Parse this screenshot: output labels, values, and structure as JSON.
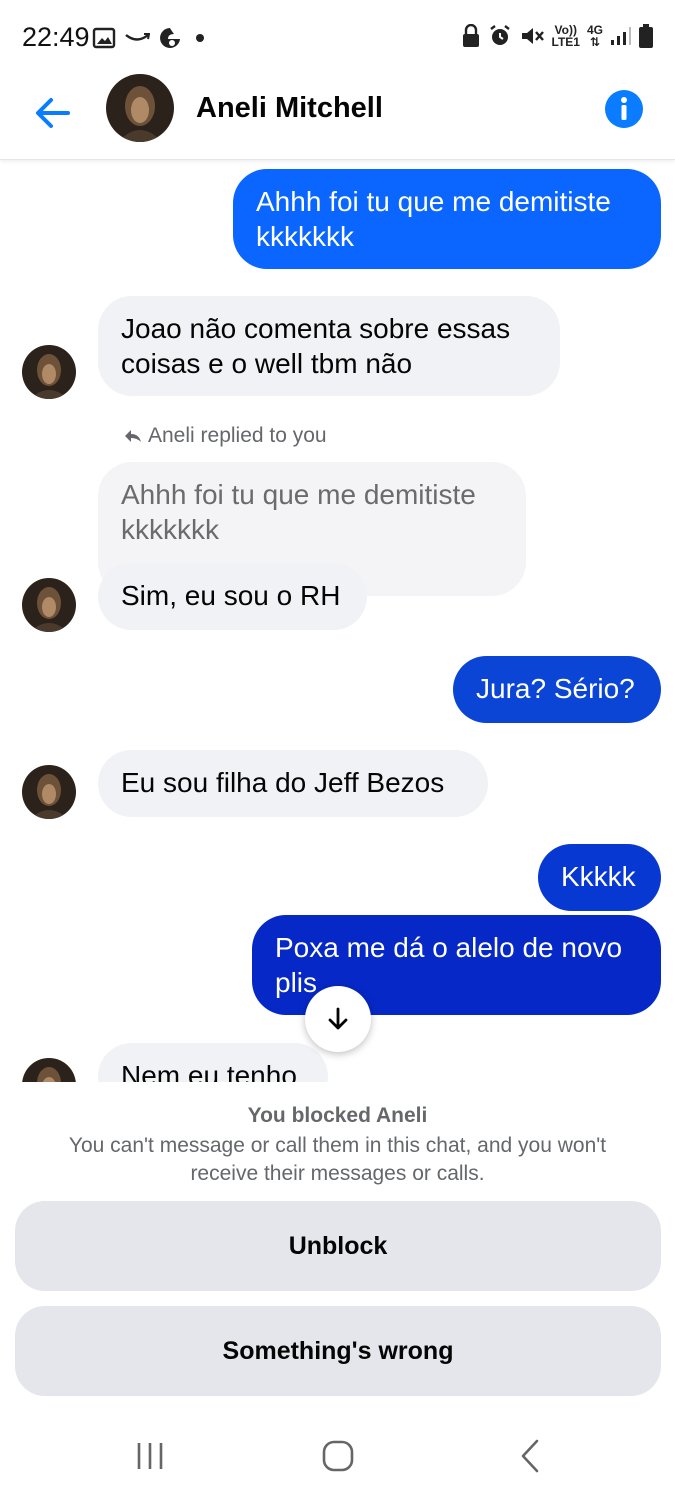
{
  "status_bar": {
    "time": "22:49",
    "left_icons": [
      "gallery-icon",
      "amazon-icon",
      "edge-icon",
      "dot-icon"
    ],
    "right_icons": [
      "lock-icon",
      "alarm-icon",
      "mute-icon",
      "volte-icon",
      "4g-icon",
      "signal-icon",
      "battery-icon"
    ],
    "volte_top": "Vo))",
    "volte_bottom": "LTE1",
    "network": "4G"
  },
  "header": {
    "contact_name": "Aneli Mitchell",
    "back_icon": "arrow-left-icon",
    "info_icon": "info-icon",
    "accent": "#0a7cff"
  },
  "messages": [
    {
      "direction": "out",
      "text": "Ahhh foi tu que me demitiste kkkkkkk",
      "color": "#0a66ff"
    },
    {
      "direction": "in",
      "text": "Joao não comenta sobre essas coisas e o well tbm não"
    },
    {
      "direction": "in",
      "reply_label": "Aneli replied to you",
      "quoted_text": "Ahhh foi tu que me demitiste kkkkkkk",
      "text": "Sim, eu sou o RH"
    },
    {
      "direction": "out",
      "text": "Jura? Sério?",
      "color": "#0b45d6"
    },
    {
      "direction": "in",
      "text": "Eu sou filha do Jeff Bezos"
    },
    {
      "direction": "out",
      "text": "Kkkkk",
      "color": "#0838d2"
    },
    {
      "direction": "out",
      "text": "Poxa me dá o alelo de novo plis",
      "color": "#0628c6"
    },
    {
      "direction": "in",
      "text": "Nem eu tenho"
    }
  ],
  "blocked": {
    "title": "You blocked Aneli",
    "description": "You can't message or call them in this chat, and you won't receive their messages or calls.",
    "unblock_label": "Unblock",
    "wrong_label": "Something's wrong"
  },
  "nav_bar": {
    "icons": [
      "recent-apps-icon",
      "home-icon",
      "back-icon"
    ]
  }
}
